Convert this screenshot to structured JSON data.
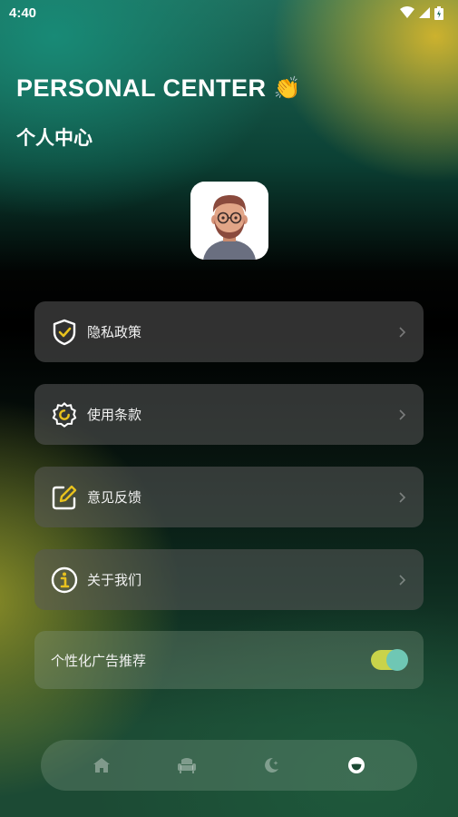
{
  "status_bar": {
    "time": "4:40"
  },
  "header": {
    "title": "PERSONAL CENTER",
    "title_emoji": "👏",
    "subtitle": "个人中心"
  },
  "menu": {
    "privacy_label": "隐私政策",
    "terms_label": "使用条款",
    "feedback_label": "意见反馈",
    "about_label": "关于我们"
  },
  "ad_setting": {
    "label": "个性化广告推荐",
    "enabled": true
  },
  "bottom_nav": {
    "items": [
      "home-icon",
      "sofa-icon",
      "moon-icon",
      "profile-icon"
    ],
    "active_index": 3
  },
  "colors": {
    "accent": "#e8c21e",
    "toggle_track": "#c9d34a",
    "toggle_knob": "#6fc7b4"
  }
}
